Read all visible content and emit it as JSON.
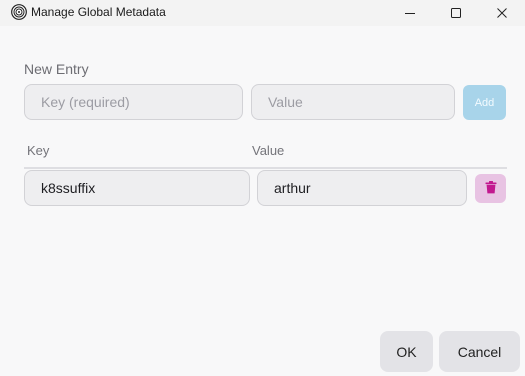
{
  "window": {
    "title": "Manage Global Metadata",
    "app_icon": "fingerprint-icon",
    "controls": [
      "minimize-icon",
      "maximize-icon",
      "close-icon"
    ]
  },
  "new_entry": {
    "section_label": "New Entry",
    "key_placeholder": "Key (required)",
    "key_value": "",
    "value_placeholder": "Value",
    "value_value": "",
    "add_label": "Add",
    "add_enabled": false
  },
  "table": {
    "headers": {
      "key": "Key",
      "value": "Value"
    },
    "rows": [
      {
        "key": "k8ssuffix",
        "value": "arthur",
        "delete_icon": "trash-icon"
      }
    ]
  },
  "footer": {
    "ok_label": "OK",
    "cancel_label": "Cancel"
  },
  "colors": {
    "add_button_disabled": "#a8d4ea",
    "delete_button": "#e8c3e3",
    "delete_icon": "#c2188f"
  }
}
